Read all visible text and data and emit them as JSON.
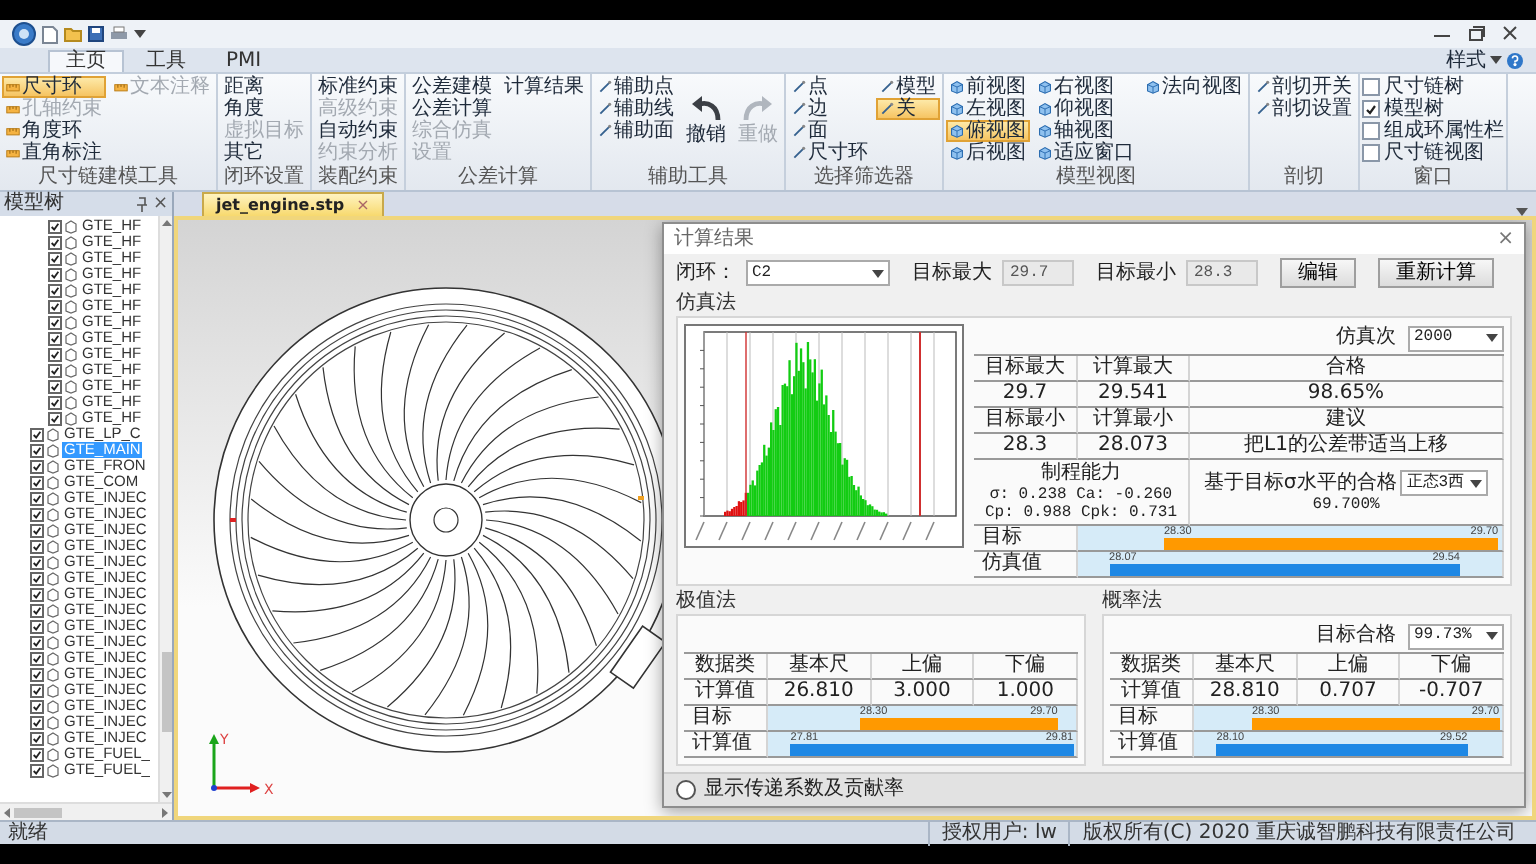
{
  "ribbon": {
    "tabs": [
      {
        "label": "主页",
        "selected": true
      },
      {
        "label": "工具",
        "selected": false
      },
      {
        "label": "PMI",
        "selected": false
      }
    ],
    "style_menu": "样式",
    "groups": [
      {
        "label": "尺寸链建模工具",
        "items": [
          {
            "label": "尺寸环",
            "kind": "icon",
            "selected": true,
            "disabled": false
          },
          {
            "label": "孔轴约束",
            "kind": "icon",
            "selected": false,
            "disabled": true
          },
          {
            "label": "角度环",
            "kind": "icon",
            "selected": false,
            "disabled": false
          },
          {
            "label": "直角标注",
            "kind": "icon",
            "selected": false,
            "disabled": false
          },
          {
            "label": "文本注释",
            "kind": "icon",
            "selected": false,
            "disabled": true
          }
        ]
      },
      {
        "label": "闭环设置",
        "items": [
          {
            "label": "距离",
            "kind": "text",
            "selected": false,
            "disabled": false
          },
          {
            "label": "角度",
            "kind": "text",
            "selected": false,
            "disabled": false
          },
          {
            "label": "虚拟目标",
            "kind": "text",
            "selected": false,
            "disabled": true
          },
          {
            "label": "其它",
            "kind": "text",
            "selected": false,
            "disabled": false
          }
        ]
      },
      {
        "label": "装配约束",
        "items": [
          {
            "label": "标准约束",
            "kind": "text",
            "selected": false,
            "disabled": false
          },
          {
            "label": "高级约束",
            "kind": "text",
            "selected": false,
            "disabled": true
          },
          {
            "label": "自动约束",
            "kind": "text",
            "selected": false,
            "disabled": false
          },
          {
            "label": "约束分析",
            "kind": "text",
            "selected": false,
            "disabled": true
          }
        ]
      },
      {
        "label": "公差计算",
        "items": [
          {
            "label": "公差建模",
            "kind": "text",
            "selected": false,
            "disabled": false
          },
          {
            "label": "公差计算",
            "kind": "text",
            "selected": false,
            "disabled": false
          },
          {
            "label": "综合仿真",
            "kind": "text",
            "selected": false,
            "disabled": true
          },
          {
            "label": "设置",
            "kind": "text",
            "selected": false,
            "disabled": true
          },
          {
            "label": "计算结果",
            "kind": "text",
            "selected": false,
            "disabled": false
          }
        ]
      },
      {
        "label": "辅助工具",
        "items": [
          {
            "label": "辅助点",
            "kind": "icon",
            "selected": false,
            "disabled": false
          },
          {
            "label": "辅助线",
            "kind": "icon",
            "selected": false,
            "disabled": false
          },
          {
            "label": "辅助面",
            "kind": "icon",
            "selected": false,
            "disabled": false
          },
          {
            "label": "撤销",
            "kind": "large",
            "selected": false,
            "disabled": false
          },
          {
            "label": "重做",
            "kind": "large",
            "selected": false,
            "disabled": true
          }
        ]
      },
      {
        "label": "选择筛选器",
        "items": [
          {
            "label": "点",
            "kind": "icon",
            "selected": false,
            "disabled": false
          },
          {
            "label": "边",
            "kind": "icon",
            "selected": false,
            "disabled": false
          },
          {
            "label": "面",
            "kind": "icon",
            "selected": false,
            "disabled": false
          },
          {
            "label": "尺寸环",
            "kind": "icon",
            "selected": false,
            "disabled": false
          },
          {
            "label": "模型",
            "kind": "icon",
            "selected": false,
            "disabled": false
          },
          {
            "label": "关",
            "kind": "icon",
            "selected": true,
            "disabled": false
          }
        ]
      },
      {
        "label": "模型视图",
        "items": [
          {
            "label": "前视图",
            "kind": "icon",
            "selected": false,
            "disabled": false
          },
          {
            "label": "左视图",
            "kind": "icon",
            "selected": false,
            "disabled": false
          },
          {
            "label": "俯视图",
            "kind": "icon",
            "selected": true,
            "disabled": false
          },
          {
            "label": "后视图",
            "kind": "icon",
            "selected": false,
            "disabled": false
          },
          {
            "label": "右视图",
            "kind": "icon",
            "selected": false,
            "disabled": false
          },
          {
            "label": "仰视图",
            "kind": "icon",
            "selected": false,
            "disabled": false
          },
          {
            "label": "轴视图",
            "kind": "icon",
            "selected": false,
            "disabled": false
          },
          {
            "label": "适应窗口",
            "kind": "icon",
            "selected": false,
            "disabled": false
          },
          {
            "label": "法向视图",
            "kind": "icon",
            "selected": false,
            "disabled": false
          }
        ]
      },
      {
        "label": "剖切",
        "items": [
          {
            "label": "剖切开关",
            "kind": "icon",
            "selected": false,
            "disabled": false
          },
          {
            "label": "剖切设置",
            "kind": "icon",
            "selected": false,
            "disabled": false
          }
        ]
      },
      {
        "label": "窗口",
        "items": [
          {
            "label": "尺寸链树",
            "kind": "check",
            "checked": false
          },
          {
            "label": "模型树",
            "kind": "check",
            "checked": true
          },
          {
            "label": "组成环属性栏",
            "kind": "check",
            "checked": false
          },
          {
            "label": "尺寸链视图",
            "kind": "check",
            "checked": false
          }
        ]
      }
    ]
  },
  "model_tree": {
    "title": "模型树",
    "close": "×",
    "items": [
      {
        "children": [
          {
            "label": "GTE_HF",
            "checked": true,
            "selected": false
          },
          {
            "label": "GTE_HF",
            "checked": true,
            "selected": false
          },
          {
            "label": "GTE_HF",
            "checked": true,
            "selected": false
          },
          {
            "label": "GTE_HF",
            "checked": true,
            "selected": false
          },
          {
            "label": "GTE_HF",
            "checked": true,
            "selected": false
          },
          {
            "label": "GTE_HF",
            "checked": true,
            "selected": false
          },
          {
            "label": "GTE_HF",
            "checked": true,
            "selected": false
          },
          {
            "label": "GTE_HF",
            "checked": true,
            "selected": false
          },
          {
            "label": "GTE_HF",
            "checked": true,
            "selected": false
          },
          {
            "label": "GTE_HF",
            "checked": true,
            "selected": false
          },
          {
            "label": "GTE_HF",
            "checked": true,
            "selected": false
          },
          {
            "label": "GTE_HF",
            "checked": true,
            "selected": false
          },
          {
            "label": "GTE_HF",
            "checked": true,
            "selected": false
          }
        ]
      },
      {
        "label": "GTE_LP_C",
        "checked": true,
        "selected": false
      },
      {
        "label": "GTE_MAIN",
        "checked": true,
        "selected": true
      },
      {
        "label": "GTE_FRON",
        "checked": true,
        "selected": false
      },
      {
        "label": "GTE_COM",
        "checked": true,
        "selected": false
      },
      {
        "label": "GTE_INJEC",
        "checked": true,
        "selected": false
      },
      {
        "label": "GTE_INJEC",
        "checked": true,
        "selected": false
      },
      {
        "label": "GTE_INJEC",
        "checked": true,
        "selected": false
      },
      {
        "label": "GTE_INJEC",
        "checked": true,
        "selected": false
      },
      {
        "label": "GTE_INJEC",
        "checked": true,
        "selected": false
      },
      {
        "label": "GTE_INJEC",
        "checked": true,
        "selected": false
      },
      {
        "label": "GTE_INJEC",
        "checked": true,
        "selected": false
      },
      {
        "label": "GTE_INJEC",
        "checked": true,
        "selected": false
      },
      {
        "label": "GTE_INJEC",
        "checked": true,
        "selected": false
      },
      {
        "label": "GTE_INJEC",
        "checked": true,
        "selected": false
      },
      {
        "label": "GTE_INJEC",
        "checked": true,
        "selected": false
      },
      {
        "label": "GTE_INJEC",
        "checked": true,
        "selected": false
      },
      {
        "label": "GTE_INJEC",
        "checked": true,
        "selected": false
      },
      {
        "label": "GTE_INJEC",
        "checked": true,
        "selected": false
      },
      {
        "label": "GTE_INJEC",
        "checked": true,
        "selected": false
      },
      {
        "label": "GTE_INJEC",
        "checked": true,
        "selected": false
      },
      {
        "label": "GTE_FUEL_",
        "checked": true,
        "selected": false
      },
      {
        "label": "GTE_FUEL_",
        "checked": true,
        "selected": false
      }
    ]
  },
  "document": {
    "tab": {
      "label": "jet_engine.stp",
      "close": "×",
      "selected": true
    },
    "axis": {
      "x": "X",
      "y": "Y"
    },
    "dialog": {
      "title": "计算结果",
      "close": "×",
      "loop": {
        "label": "闭环：",
        "value": "C2"
      },
      "target_max": {
        "label": "目标最大",
        "value": "29.7"
      },
      "target_min": {
        "label": "目标最小",
        "value": "28.3"
      },
      "buttons": [
        "编辑",
        "重新计算"
      ],
      "simulation": {
        "title": "仿真法",
        "runs": {
          "label": "仿真次",
          "value": "2000"
        },
        "rows": [
          [
            "目标最大",
            "计算最大",
            "合格"
          ],
          [
            "29.7",
            "29.541",
            "98.65%"
          ],
          [
            "目标最小",
            "计算最小",
            "建议"
          ],
          [
            "28.3",
            "28.073",
            "把L1的公差带适当上移"
          ]
        ],
        "capability": {
          "title": "制程能力",
          "lines": [
            "σ: 0.238 Ca: -0.260",
            "Cp: 0.988 Cpk: 0.731"
          ]
        },
        "sigma_pass": {
          "label": "基于目标σ水平的合格",
          "option": "正态3西",
          "value": "69.700%"
        },
        "range_bars": [
          {
            "label": "目标",
            "low": "28.30",
            "high": "29.70",
            "color": "#ff9900"
          },
          {
            "label": "仿真值",
            "low": "28.07",
            "high": "29.54",
            "color": "#1e88e5"
          }
        ]
      },
      "extreme": {
        "title": "极值法",
        "columns": [
          "数据类",
          "基本尺",
          "上偏",
          "下偏"
        ],
        "rows": [
          [
            "计算值",
            "26.810",
            "3.000",
            "1.000"
          ]
        ],
        "range_bars": [
          {
            "label": "目标",
            "low": "28.30",
            "high": "29.70",
            "color": "#ff9900"
          },
          {
            "label": "计算值",
            "low": "27.81",
            "high": "29.81",
            "color": "#1e88e5"
          }
        ]
      },
      "probability": {
        "title": "概率法",
        "pass_rate": {
          "label": "目标合格",
          "value": "99.73%"
        },
        "columns": [
          "数据类",
          "基本尺",
          "上偏",
          "下偏"
        ],
        "rows": [
          [
            "计算值",
            "28.810",
            "0.707",
            "-0.707"
          ]
        ],
        "range_bars": [
          {
            "label": "目标",
            "low": "28.30",
            "high": "29.70",
            "color": "#ff9900"
          },
          {
            "label": "计算值",
            "low": "28.10",
            "high": "29.52",
            "color": "#1e88e5"
          }
        ]
      },
      "option": {
        "label": "显示传递系数及贡献率",
        "checked": false
      }
    }
  },
  "status_bar": {
    "status": "就绪",
    "user": "授权用户: lw",
    "copyright": "版权所有(C) 2020 重庆诚智鹏科技有限责任公司"
  }
}
